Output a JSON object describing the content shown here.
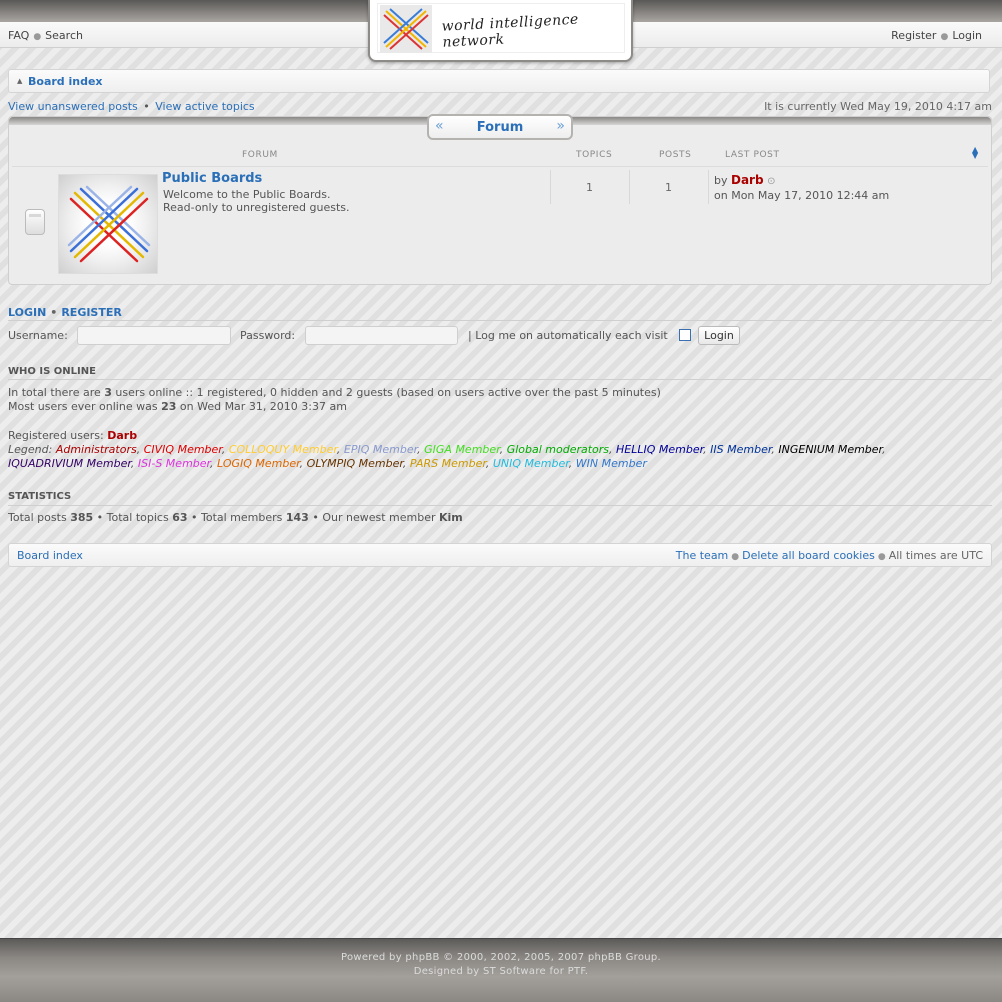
{
  "nav": {
    "faq": "FAQ",
    "search": "Search",
    "register": "Register",
    "login": "Login"
  },
  "logo": {
    "text": "world intelligence network"
  },
  "breadcrumb": {
    "board_index": "Board index"
  },
  "sublinks": {
    "unanswered": "View unanswered posts",
    "active": "View active topics",
    "separator": "•"
  },
  "timestamp": "It is currently Wed May 19, 2010 4:17 am",
  "forum_table": {
    "tab_label": "Forum",
    "headers": {
      "forum": "FORUM",
      "topics": "TOPICS",
      "posts": "POSTS",
      "last_post": "LAST POST"
    },
    "rows": [
      {
        "title": "Public Boards",
        "desc_line1": "Welcome to the Public Boards.",
        "desc_line2": "Read-only to unregistered guests.",
        "topics": "1",
        "posts": "1",
        "last_by_prefix": "by",
        "last_by_user": "Darb",
        "last_on": "on Mon May 17, 2010 12:44 am"
      }
    ]
  },
  "login_form": {
    "title_login": "LOGIN",
    "title_register": "REGISTER",
    "username_label": "Username:",
    "password_label": "Password:",
    "auto_label": "| Log me on automatically each visit",
    "button": "Login"
  },
  "who_is_online": {
    "title": "WHO IS ONLINE",
    "line1_prefix": "In total there are",
    "line1_count": "3",
    "line1_suffix": "users online :: 1 registered, 0 hidden and 2 guests (based on users active over the past 5 minutes)",
    "line2_prefix": "Most users ever online was",
    "line2_count": "23",
    "line2_suffix": "on Wed Mar 31, 2010 3:37 am",
    "registered_label": "Registered users:",
    "registered_user": "Darb",
    "legend_label": "Legend:",
    "groups_line1": [
      {
        "name": "Administrators",
        "color": "#aa0000"
      },
      {
        "name": "CIVIQ Member",
        "color": "#dd0000"
      },
      {
        "name": "COLLOQUY Member",
        "color": "#ffcc33"
      },
      {
        "name": "EPIQ Member",
        "color": "#8899cc"
      },
      {
        "name": "GIGA Member",
        "color": "#44dd22"
      },
      {
        "name": "Global moderators",
        "color": "#00aa00"
      },
      {
        "name": "HELLIQ Member",
        "color": "#000099"
      },
      {
        "name": "IIS Member",
        "color": "#003399"
      },
      {
        "name": "INGENIUM Member",
        "color": "#000000"
      }
    ],
    "groups_line2": [
      {
        "name": "IQUADRIVIUM Member",
        "color": "#330066"
      },
      {
        "name": "ISI-S Member",
        "color": "#dd33dd"
      },
      {
        "name": "LOGIQ Member",
        "color": "#dd6600"
      },
      {
        "name": "OLYMPIQ Member",
        "color": "#663300"
      },
      {
        "name": "PARS Member",
        "color": "#cc9900"
      },
      {
        "name": "UNIQ Member",
        "color": "#22bbdd"
      },
      {
        "name": "WIN Member",
        "color": "#3377cc"
      }
    ]
  },
  "statistics": {
    "title": "STATISTICS",
    "posts_label": "Total posts",
    "posts": "385",
    "topics_label": "Total topics",
    "topics": "63",
    "members_label": "Total members",
    "members": "143",
    "newest_label": "Our newest member",
    "newest": "Kim"
  },
  "bottom_bar": {
    "board_index": "Board index",
    "team": "The team",
    "delete_cookies": "Delete all board cookies",
    "times": "All times are UTC"
  },
  "footer": {
    "line1": "Powered by phpBB © 2000, 2002, 2005, 2007 phpBB Group.",
    "line2": "Designed by ST Software for PTF."
  },
  "icons": {
    "nav_separator": "bullet-icon",
    "breadcrumb": "triangle-up-icon",
    "sort": "sort-arrows-icon",
    "status": "forum-read-icon",
    "goto": "goto-post-icon"
  }
}
